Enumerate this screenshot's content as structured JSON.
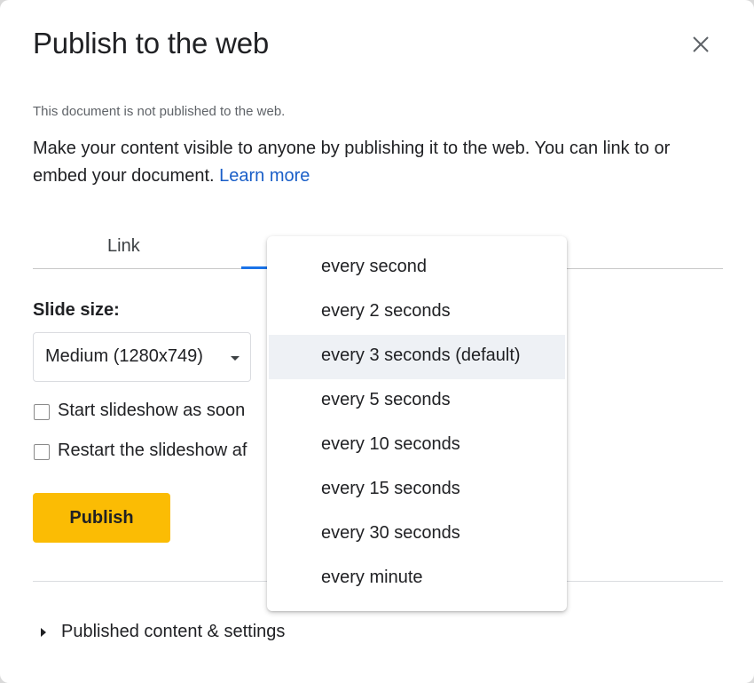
{
  "dialog": {
    "title": "Publish to the web",
    "close_icon": "close-icon",
    "status": "This document is not published to the web.",
    "description": "Make your content visible to anyone by publishing it to the web. You can link to or embed your document.",
    "learn_more": "Learn more",
    "colors": {
      "accent": "#1a73e8",
      "link": "#1a5fc8",
      "publish_bg": "#fbbc04"
    }
  },
  "tabs": {
    "link_label": "Link"
  },
  "settings": {
    "slide_size_label": "Slide size:",
    "slide_size_value": "Medium (1280x749)",
    "checkbox_start": "Start slideshow as soon",
    "checkbox_restart": "Restart the slideshow af"
  },
  "publish_button": "Publish",
  "published_content": "Published content & settings",
  "dropdown": {
    "options": [
      "every second",
      "every 2 seconds",
      "every 3 seconds (default)",
      "every 5 seconds",
      "every 10 seconds",
      "every 15 seconds",
      "every 30 seconds",
      "every minute"
    ],
    "selected": "every 3 seconds (default)"
  }
}
